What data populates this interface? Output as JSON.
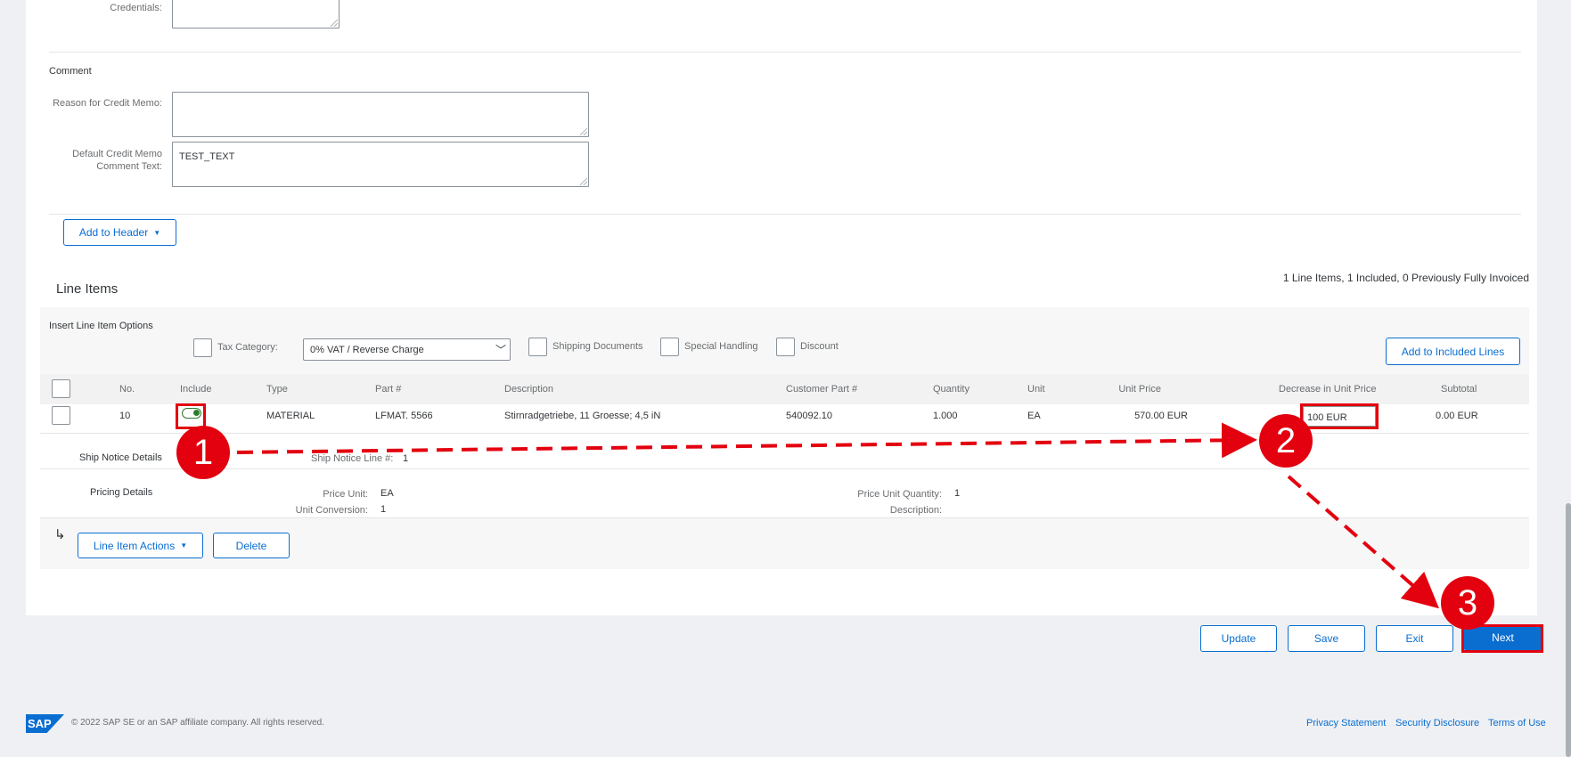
{
  "header": {
    "credentials_label": "Credentials:"
  },
  "comment": {
    "section_title": "Comment",
    "reason_label": "Reason for Credit Memo:",
    "reason_value": "",
    "default_label_line1": "Default Credit Memo",
    "default_label_line2": "Comment Text:",
    "default_value": "TEST_TEXT"
  },
  "add_to_header_button": "Add to Header",
  "line_items": {
    "title": "Line Items",
    "summary": "1 Line Items,  1 Included,  0 Previously Fully Invoiced",
    "insert_options_label": "Insert Line Item Options",
    "tax_category_label": "Tax Category:",
    "tax_category_value": "0% VAT / Reverse Charge",
    "shipping_documents_label": "Shipping Documents",
    "special_handling_label": "Special Handling",
    "discount_label": "Discount",
    "add_to_included_lines_button": "Add to Included Lines",
    "columns": {
      "no": "No.",
      "include": "Include",
      "type": "Type",
      "part": "Part #",
      "description": "Description",
      "customer_part": "Customer Part #",
      "quantity": "Quantity",
      "unit": "Unit",
      "unit_price": "Unit Price",
      "decrease": "Decrease in Unit Price",
      "subtotal": "Subtotal"
    },
    "row": {
      "no": "10",
      "type": "MATERIAL",
      "part": "LFMAT. 5566",
      "description": "Stirnradgetriebe, 11 Groesse; 4,5 iN",
      "customer_part": "540092.10",
      "quantity": "1.000",
      "unit": "EA",
      "unit_price": "570.00 EUR",
      "decrease": "100 EUR",
      "subtotal": "0.00 EUR"
    },
    "ship_notice_details_label": "Ship Notice Details",
    "ship_notice_line_label": "Ship Notice Line #:",
    "ship_notice_line_value": "1",
    "pricing_details_label": "Pricing Details",
    "price_unit_label": "Price Unit:",
    "price_unit_value": "EA",
    "unit_conversion_label": "Unit Conversion:",
    "unit_conversion_value": "1",
    "price_unit_quantity_label": "Price Unit Quantity:",
    "price_unit_quantity_value": "1",
    "description_label": "Description:",
    "description_value": "",
    "return_arrow": "↳",
    "line_item_actions_button": "Line Item Actions",
    "delete_button": "Delete"
  },
  "footer_actions": {
    "update": "Update",
    "save": "Save",
    "exit": "Exit",
    "next": "Next"
  },
  "annotations": {
    "step1": "1",
    "step2": "2",
    "step3": "3"
  },
  "footer": {
    "logo_text": "SAP",
    "copyright": "© 2022 SAP SE or an SAP affiliate company. All rights reserved.",
    "privacy": "Privacy Statement",
    "security": "Security Disclosure",
    "terms": "Terms of Use"
  },
  "colors": {
    "accent": "#0a6ed1",
    "annotation_red": "#e3000f"
  }
}
